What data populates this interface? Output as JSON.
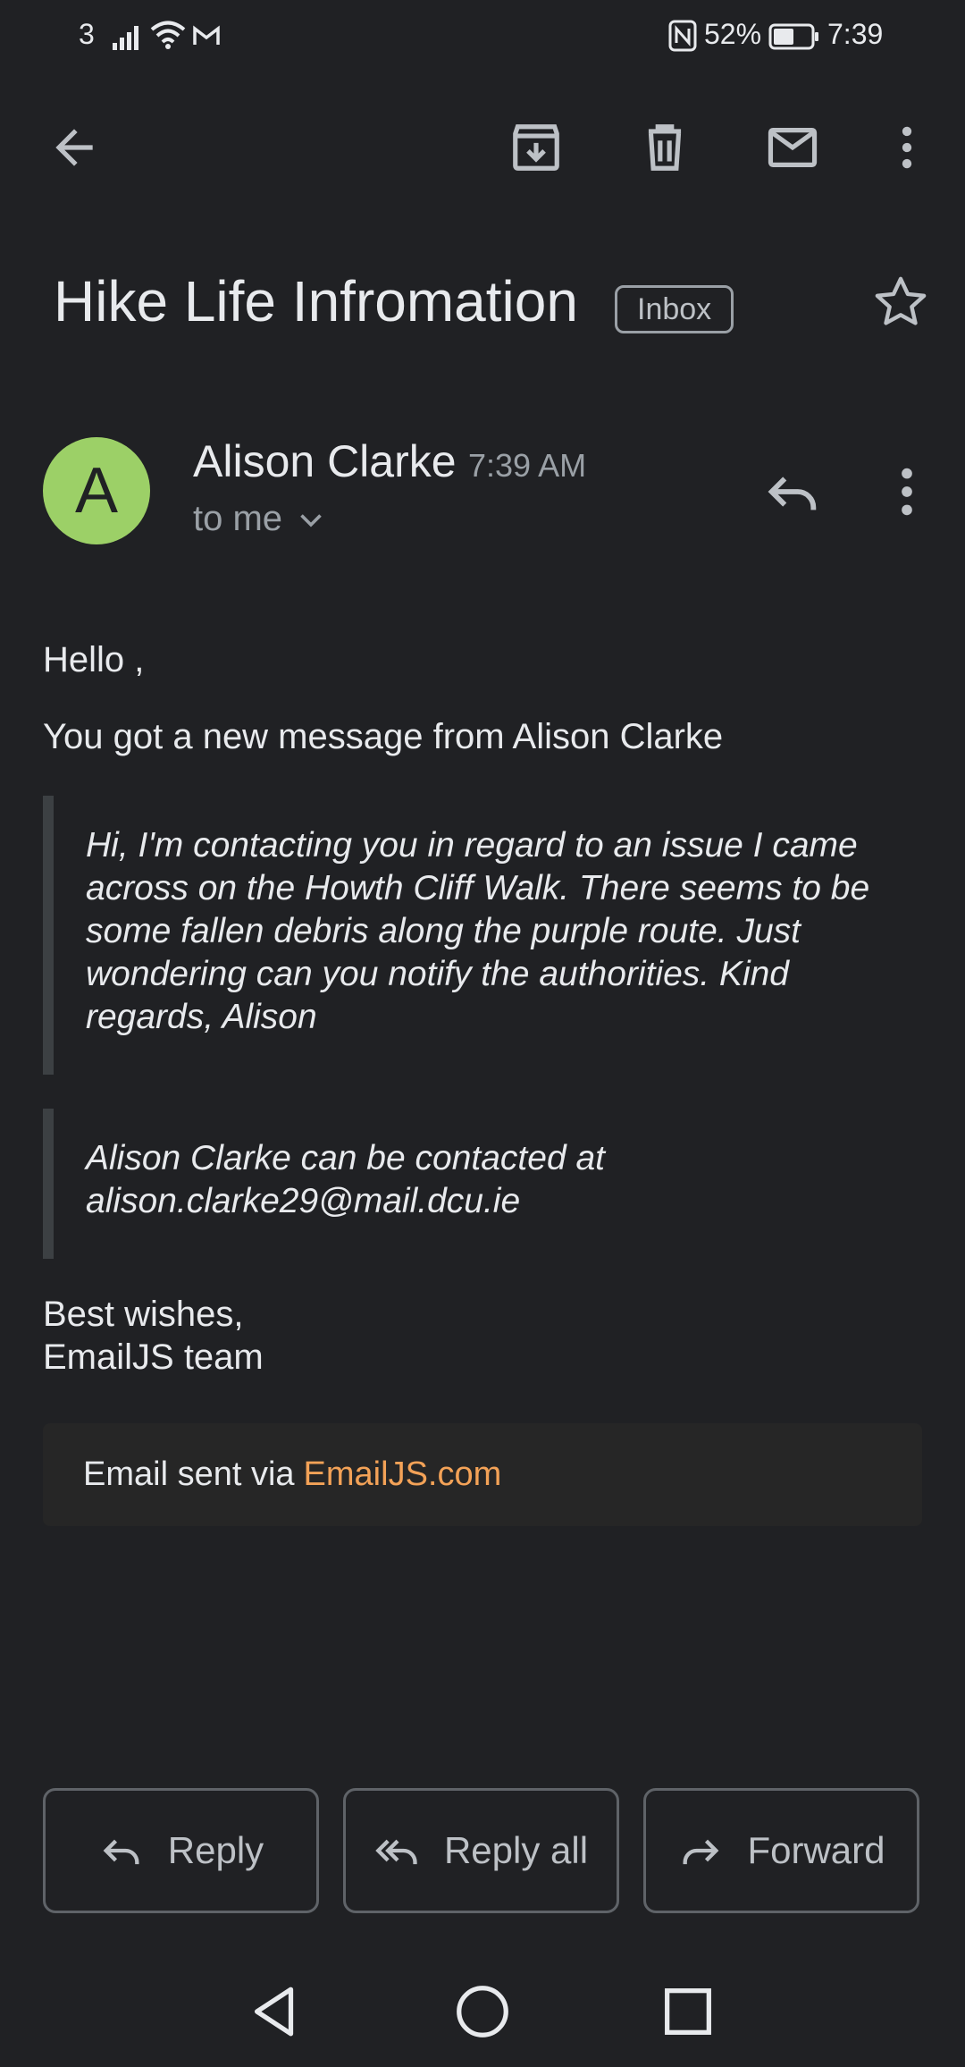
{
  "status_bar": {
    "carrier": "3",
    "battery": "52%",
    "time": "7:39"
  },
  "toolbar": {
    "back_icon": "arrow-left-icon",
    "archive_icon": "archive-icon",
    "delete_icon": "trash-icon",
    "mark_unread_icon": "mail-icon",
    "more_icon": "more-vert-icon"
  },
  "email": {
    "subject": "Hike Life Infromation",
    "label": "Inbox",
    "sender": {
      "initial": "A",
      "name": "Alison Clarke",
      "time": "7:39 AM",
      "recipient": "to me",
      "avatar_color": "#9cd067"
    },
    "greeting": "Hello ,",
    "intro": "You got a new message from Alison Clarke",
    "message": "Hi, I'm contacting you in regard to an issue I came across on the Howth Cliff Walk. There seems to be some fallen debris along the purple route. Just wondering can you notify the authorities. Kind regards, Alison",
    "contact_text": "Alison Clarke can be contacted at",
    "contact_email": "alison.clarke29@mail.dcu.ie",
    "closing_line1": "Best wishes,",
    "closing_line2": "EmailJS team",
    "footer_text": "Email sent via",
    "footer_link": "EmailJS.com"
  },
  "actions": {
    "reply": "Reply",
    "reply_all": "Reply all",
    "forward": "Forward"
  },
  "colors": {
    "background": "#202124",
    "link": "#5d9cf5",
    "footer_link": "#f3a257"
  }
}
